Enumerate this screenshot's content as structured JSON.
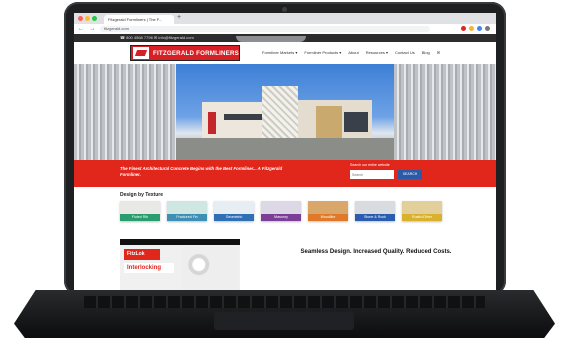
{
  "browser": {
    "tab_title": "Fitzgerald Formliners | The F...",
    "new_tab": "+",
    "url": "fitzgerald.com",
    "nav_icons": "← → ⟳"
  },
  "site": {
    "topbar": "☎ 800 4568 7796   ✉ info@fitzgerald.com",
    "logo_text": "FITZGERALD FORMLINERS",
    "nav": [
      "Formliner Markets ▾",
      "Formliner Products ▾",
      "About",
      "Resources ▾",
      "Contact Us",
      "Blog",
      "✉"
    ],
    "tagline": "The Finest Architectural Concrete Begins with the Best Formliner... A Fitzgerald Formliner.",
    "search": {
      "label": "Search our entire website",
      "placeholder": "Search",
      "button": "SEARCH"
    },
    "section_title": "Design by Texture",
    "textures": [
      {
        "label": "Fluted Rib",
        "color": "#2a9d6e",
        "img": "#e8e8e4"
      },
      {
        "label": "Fractured Fin",
        "color": "#3d8fb5",
        "img": "#cfe7e2"
      },
      {
        "label": "Geometric",
        "color": "#2f6fb5",
        "img": "#e6eef4"
      },
      {
        "label": "Masonry",
        "color": "#7b3f98",
        "img": "#ddd8e6"
      },
      {
        "label": "Woodlike",
        "color": "#e07a2a",
        "img": "#d9a76a"
      },
      {
        "label": "Stone & Rock",
        "color": "#2a5db0",
        "img": "#d8dbe0"
      },
      {
        "label": "Rustic/Other",
        "color": "#d9b12e",
        "img": "#e3cf9a"
      }
    ],
    "product": {
      "badge1": "FitzLok",
      "badge2": "Interlocking"
    },
    "headline": "Seamless Design. Increased Quality. Reduced Costs."
  }
}
